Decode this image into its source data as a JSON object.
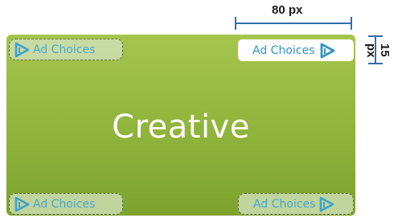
{
  "creative": {
    "label": "Creative",
    "background_color": "#93b63f"
  },
  "ad_choices": {
    "top_left_label": "Ad Choices",
    "top_right_label": "Ad Choices",
    "bottom_left_label": "Ad Choices",
    "bottom_right_label": "Ad Choices",
    "text_color": "#2f95c2",
    "icon": "ad-choices-triangle-icon"
  },
  "dimensions": {
    "width_label": "80 px",
    "height_label": "15 px",
    "line_color": "#2f6fb0"
  }
}
